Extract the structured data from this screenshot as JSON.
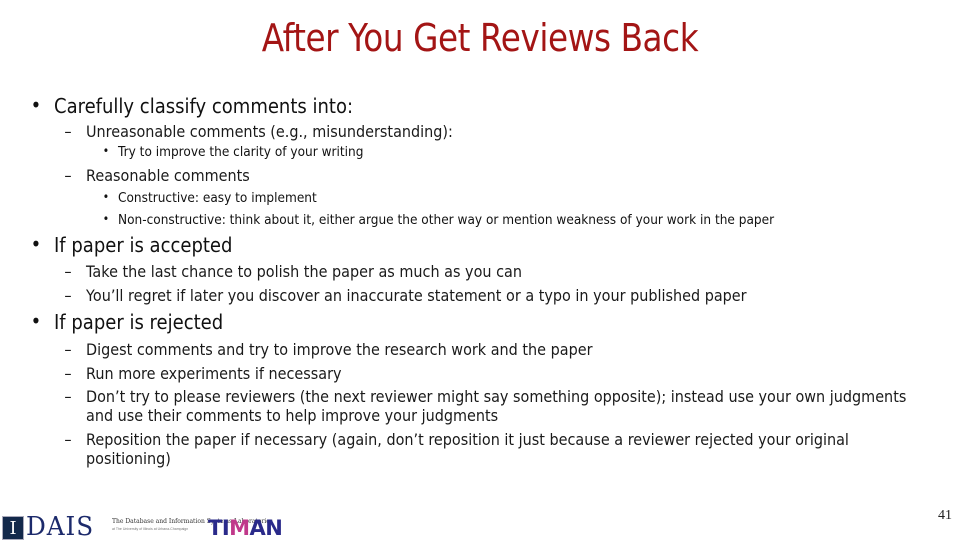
{
  "slide": {
    "title": "After You Get Reviews Back",
    "title_color": "#a31515",
    "page_number": "41"
  },
  "bullets": [
    {
      "marker": "•",
      "text": "Carefully classify comments into:",
      "children": [
        {
          "marker": "–",
          "text": "Unreasonable comments (e.g., misunderstanding):",
          "children": [
            {
              "marker": "•",
              "text": "Try to improve the clarity of your writing"
            }
          ]
        },
        {
          "marker": "–",
          "text": "Reasonable comments",
          "children": [
            {
              "marker": "•",
              "text": "Constructive: easy to implement"
            },
            {
              "marker": "•",
              "text": "Non-constructive: think about it, either argue the other way or mention weakness of your work in the paper"
            }
          ]
        }
      ]
    },
    {
      "marker": "•",
      "text": "If paper is accepted",
      "children": [
        {
          "marker": "–",
          "text": "Take the last chance to polish the paper as much as you can"
        },
        {
          "marker": "–",
          "text": "You’ll regret if later you discover an inaccurate statement or a typo in your published paper"
        }
      ]
    },
    {
      "marker": "•",
      "text": "If paper is rejected",
      "children": [
        {
          "marker": "–",
          "text": "Digest comments and try to improve the research work and the paper"
        },
        {
          "marker": "–",
          "text": "Run more experiments if necessary"
        },
        {
          "marker": "–",
          "text": "Don’t try to please reviewers (the next reviewer might say something opposite); instead use your own judgments and use their comments to help improve your judgments"
        },
        {
          "marker": "–",
          "text": "Reposition the paper if necessary (again, don’t reposition it just because a reviewer rejected your original positioning)"
        }
      ]
    }
  ],
  "footer": {
    "uiuc_logo_glyph": "I",
    "dais_logo_text": "DAIS",
    "dais_logo_subtitle": "The Database and Information Systems Laboratories",
    "dais_logo_subtitle2": "at The University of Illinois at Urbana-Champaign",
    "timan_logo_prefix": "TI",
    "timan_logo_m": "M",
    "timan_logo_suffix": "AN"
  }
}
